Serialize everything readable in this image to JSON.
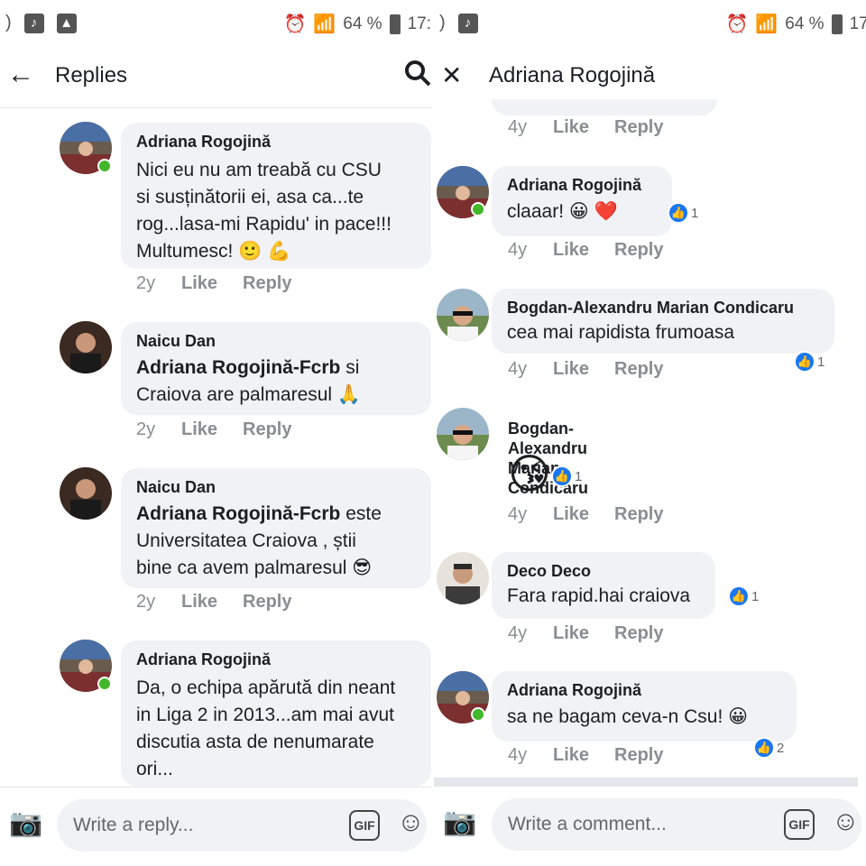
{
  "left": {
    "status": {
      "battery": "64 %",
      "time": "17:",
      "icons": [
        "brightness-icon",
        "music-app-icon",
        "gallery-icon",
        "alarm-icon",
        "wifi-icon",
        "signal-icon",
        "battery-icon"
      ]
    },
    "header": {
      "back_icon": "←",
      "title": "Replies",
      "search_icon": "search"
    },
    "comments": [
      {
        "author": "Adriana Rogojină",
        "text": "Nici eu nu am treabă cu CSU\nsi susținătorii ei, asa ca...te\nrog...lasa-mi Rapidu' in pace!!!\nMultumesc! 🙂 💪",
        "age": "2y",
        "like": "Like",
        "reply": "Reply",
        "online": true
      },
      {
        "author": "Naicu Dan",
        "mention": "Adriana Rogojină-Fcrb",
        "text_after": "  si",
        "text": "Craiova are  palmaresul 🙏",
        "age": "2y",
        "like": "Like",
        "reply": "Reply"
      },
      {
        "author": "Naicu Dan",
        "mention": "Adriana Rogojină-Fcrb",
        "text_after": "  este",
        "text": "Universitatea Craiova , știi\nbine ca avem palmaresul 😎",
        "age": "2y",
        "like": "Like",
        "reply": "Reply"
      },
      {
        "author": "Adriana Rogojină",
        "text": "Da, o echipa apărută din neant\nin Liga 2 in 2013...am mai avut\ndiscutia asta de nenumarate\nori...",
        "online": true
      }
    ],
    "composer": {
      "placeholder": "Write a reply...",
      "gif": "GIF"
    }
  },
  "right": {
    "status": {
      "battery": "64 %",
      "time": "17:"
    },
    "header": {
      "close_icon": "✕",
      "title": "Adriana Rogojină"
    },
    "top_actions": {
      "age": "4y",
      "like": "Like",
      "reply": "Reply"
    },
    "comments": [
      {
        "author": "Adriana Rogojină",
        "text": "claaar! 😀 ❤️",
        "age": "4y",
        "like": "Like",
        "reply": "Reply",
        "reactions": "1",
        "online": true
      },
      {
        "author": "Bogdan-Alexandru Marian Condicaru",
        "text": "cea mai rapidista frumoasa",
        "age": "4y",
        "like": "Like",
        "reply": "Reply",
        "reactions": "1"
      },
      {
        "author": "Bogdan-Alexandru Marian Condicaru",
        "emoji": "😘",
        "age": "4y",
        "like": "Like",
        "reply": "Reply",
        "reactions": "1"
      },
      {
        "author": "Deco Deco",
        "text": "Fara rapid.hai craiova",
        "age": "4y",
        "like": "Like",
        "reply": "Reply",
        "reactions": "1"
      },
      {
        "author": "Adriana Rogojină",
        "text": "sa ne bagam ceva-n Csu! 😀",
        "age": "4y",
        "like": "Like",
        "reply": "Reply",
        "reactions": "2",
        "online": true
      }
    ],
    "composer": {
      "placeholder": "Write a comment...",
      "gif": "GIF"
    }
  },
  "colors": {
    "bubble": "#f0f2f5",
    "online": "#42b72a",
    "like_blue": "#1877f2",
    "meta_grey": "#8a8d91"
  }
}
